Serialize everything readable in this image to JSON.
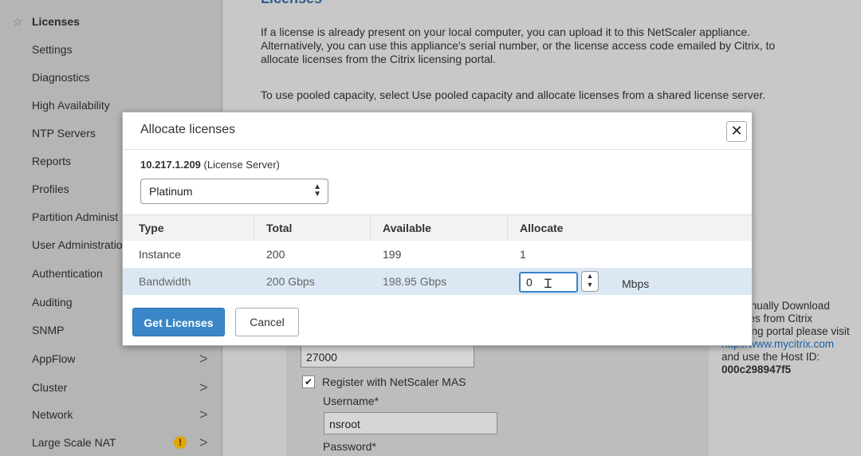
{
  "sidebar": {
    "items": [
      {
        "label": "Licenses",
        "active": true,
        "icon": "star-icon"
      },
      {
        "label": "Settings"
      },
      {
        "label": "Diagnostics"
      },
      {
        "label": "High Availability"
      },
      {
        "label": "NTP Servers"
      },
      {
        "label": "Reports"
      },
      {
        "label": "Profiles"
      },
      {
        "label": "Partition Administ"
      },
      {
        "label": "User Administratio"
      },
      {
        "label": "Authentication"
      },
      {
        "label": "Auditing"
      },
      {
        "label": "SNMP"
      },
      {
        "label": "AppFlow",
        "chevron": ">"
      },
      {
        "label": "Cluster",
        "chevron": ">"
      },
      {
        "label": "Network",
        "chevron": ">"
      },
      {
        "label": "Large Scale NAT",
        "chevron": ">",
        "warning": "!"
      }
    ]
  },
  "main": {
    "heading": "Licenses",
    "para1": "If a license is already present on your local computer, you can upload it to this NetScaler appliance. Alternatively, you can use this appliance's serial number, or the license access code emailed by Citrix, to allocate licenses from the Citrix licensing portal.",
    "para2": "To use pooled capacity, select Use pooled capacity and allocate licenses from a shared license server.",
    "port_value": "27000",
    "register_label": "Register with NetScaler MAS",
    "register_checked": true,
    "username_label": "Username*",
    "username_value": "nsroot",
    "password_label": "Password*",
    "right_note": {
      "text1": "To manually Download licenses from Citrix licensing portal please visit",
      "link": "http://www.mycitrix.com",
      "text2": "and use the Host ID:",
      "host_id": "000c298947f5"
    }
  },
  "modal": {
    "title": "Allocate licenses",
    "close": "✕",
    "server_ip": "10.217.1.209",
    "server_suffix": " (License Server)",
    "edition_selected": "Platinum",
    "columns": [
      "Type",
      "Total",
      "Available",
      "Allocate"
    ],
    "rows": [
      {
        "type": "Instance",
        "total": "200",
        "available": "199",
        "allocate": "1"
      },
      {
        "type": "Bandwidth",
        "total": "200 Gbps",
        "available": "198.95 Gbps",
        "allocate": "0",
        "unit": "Mbps"
      }
    ],
    "get_licenses_label": "Get Licenses",
    "cancel_label": "Cancel"
  }
}
